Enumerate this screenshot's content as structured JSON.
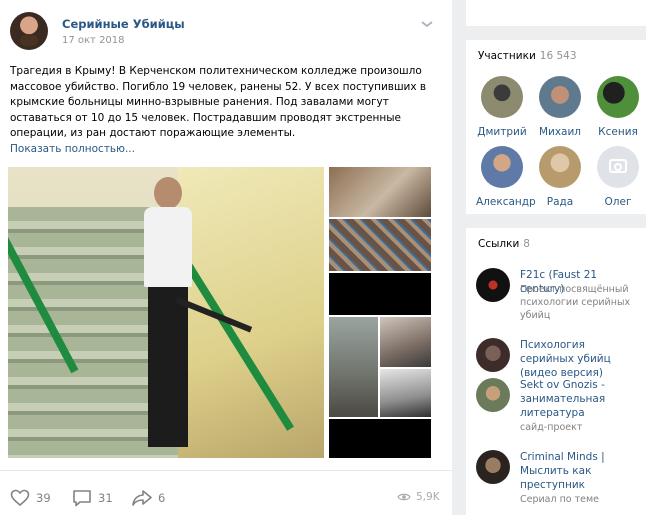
{
  "post": {
    "author": "Серийные Убийцы",
    "date": "17 окт 2018",
    "text": "Трагедия в Крыму! В Керченском политехническом колледже произошло массовое убийство. Погибло 19 человек, ранены 52. У всех поступивших в крымские больницы минно-взрывные ранения. Под завалами могут оставаться от 10 до 15 человек. Пострадавшим проводят экстренные операции, из ран достают поражающие элементы.",
    "show_more": "Показать полностью...",
    "likes": "39",
    "comments": "31",
    "shares": "6",
    "views": "5,9K"
  },
  "members": {
    "title": "Участники",
    "count": "16 543",
    "people": [
      {
        "name": "Дмитрий"
      },
      {
        "name": "Михаил"
      },
      {
        "name": "Ксения"
      },
      {
        "name": "Александр"
      },
      {
        "name": "Рада"
      },
      {
        "name": "Олег"
      }
    ]
  },
  "links": {
    "title": "Ссылки",
    "count": "8",
    "items": [
      {
        "title": "F21c (Faust 21 century)",
        "desc": "Проект посвящённый психологии серийных убийц"
      },
      {
        "title": "Психология серийных убийц (видео версия)",
        "desc": ""
      },
      {
        "title": "Sekt ov Gnozis - занимательная литература",
        "desc": "сайд-проект"
      },
      {
        "title": "Criminal Minds | Мыслить как преступник",
        "desc": "Сериал по теме"
      }
    ]
  },
  "icons": {
    "like": "heart-icon",
    "comment": "comment-icon",
    "share": "share-icon",
    "views": "eye-icon",
    "menu": "chevron-down-icon",
    "no_photo": "camera-icon"
  },
  "colors": {
    "link": "#2a5885",
    "muted": "#828282",
    "rail": "#1f8b3f"
  }
}
